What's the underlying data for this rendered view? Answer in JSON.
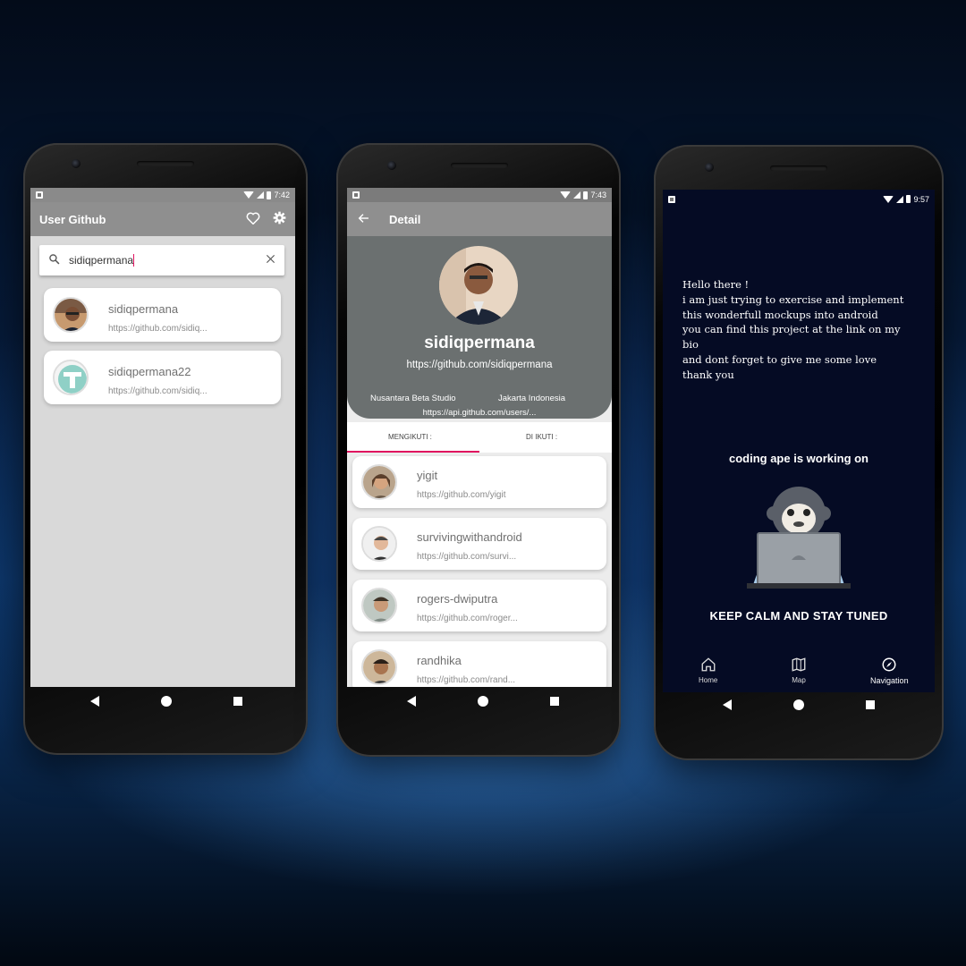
{
  "phone1": {
    "status_time": "7:42",
    "appbar_title": "User Github",
    "search_query": "sidiqpermana",
    "results": [
      {
        "name": "sidiqpermana",
        "url": "https://github.com/sidiq..."
      },
      {
        "name": "sidiqpermana22",
        "url": "https://github.com/sidiq..."
      }
    ]
  },
  "phone2": {
    "status_time": "7:43",
    "appbar_title": "Detail",
    "profile": {
      "username": "sidiqpermana",
      "url": "https://github.com/sidiqpermana",
      "company": "Nusantara Beta Studio",
      "location": "Jakarta Indonesia",
      "api_url": "https://api.github.com/users/..."
    },
    "tabs": [
      "MENGIKUTI :",
      "DI IKUTI :"
    ],
    "following": [
      {
        "name": "yigit",
        "url": "https://github.com/yigit"
      },
      {
        "name": "survivingwithandroid",
        "url": "https://github.com/survi..."
      },
      {
        "name": "rogers-dwiputra",
        "url": "https://github.com/roger..."
      },
      {
        "name": "randhika",
        "url": "https://github.com/rand..."
      }
    ]
  },
  "phone3": {
    "status_time": "9:57",
    "bio": "Hello there !\ni am just trying to exercise and implement\nthis wonderfull mockups into android\nyou can find this project at the link on my\nbio\nand dont forget to give me some love\nthank you",
    "working_text": "coding ape is working on",
    "tagline": "KEEP CALM AND STAY TUNED",
    "nav": [
      {
        "label": "Home",
        "icon": "home-icon"
      },
      {
        "label": "Map",
        "icon": "map-icon"
      },
      {
        "label": "Navigation",
        "icon": "compass-icon"
      }
    ]
  },
  "colors": {
    "accent": "#e0115f",
    "appbar": "#8f8f8f",
    "profile_bg": "#6b7070",
    "dark_screen": "#050b24"
  }
}
